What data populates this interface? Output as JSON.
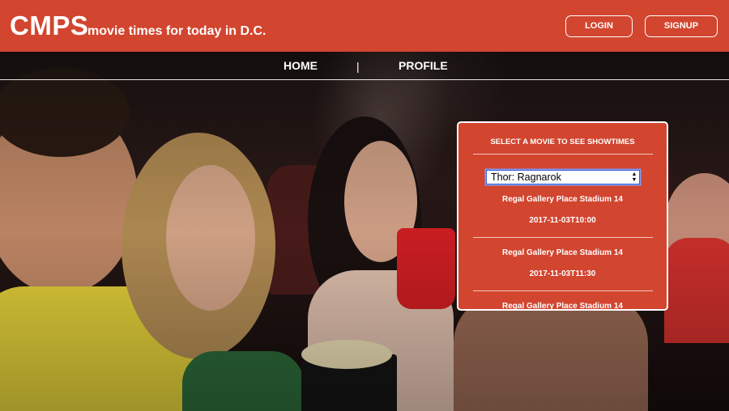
{
  "header": {
    "brand": "CMPS",
    "tagline": "movie times for today in D.C.",
    "login_label": "LOGIN",
    "signup_label": "SIGNUP",
    "background_color": "#d2452f"
  },
  "nav": {
    "home_label": "HOME",
    "separator": "|",
    "profile_label": "PROFILE"
  },
  "showtimes_panel": {
    "title": "SELECT A MOVIE TO SEE SHOWTIMES",
    "selected_movie": "Thor: Ragnarok",
    "showtimes": [
      {
        "theater": "Regal Gallery Place Stadium 14",
        "time": "2017-11-03T10:00"
      },
      {
        "theater": "Regal Gallery Place Stadium 14",
        "time": "2017-11-03T11:30"
      },
      {
        "theater": "Regal Gallery Place Stadium 14",
        "time": ""
      }
    ]
  }
}
